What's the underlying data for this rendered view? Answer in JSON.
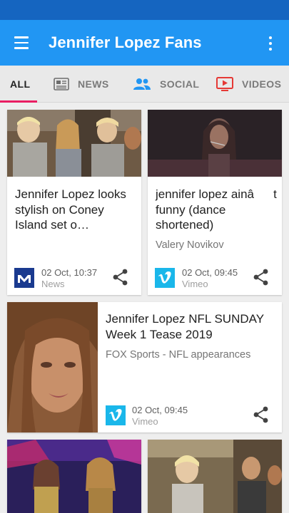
{
  "app": {
    "title": "Jennifer Lopez Fans",
    "menu_icon": "hamburger-menu-icon",
    "more_icon": "more-vert-icon"
  },
  "colors": {
    "appbar": "#2196f3",
    "statusbar": "#1565c0",
    "tab_indicator": "#e91e63",
    "videos_icon": "#e53935",
    "social_icon": "#2196f3"
  },
  "tabs": [
    {
      "label": "ALL",
      "icon": null,
      "active": true
    },
    {
      "label": "NEWS",
      "icon": "newspaper-icon",
      "active": false
    },
    {
      "label": "SOCIAL",
      "icon": "people-icon",
      "active": false
    },
    {
      "label": "VIDEOS",
      "icon": "video-play-icon",
      "active": false
    }
  ],
  "cards": [
    {
      "title": "Jennifer Lopez looks stylish on Coney Island set o…",
      "source": "",
      "date": "02 Oct, 10:37",
      "category": "News",
      "badge": "m-news-logo-icon"
    },
    {
      "title": "jennifer lopez ainât funny (dance shortened)",
      "source": "Valery Novikov",
      "date": "02 Oct, 09:45",
      "category": "Vimeo",
      "badge": "vimeo-logo-icon"
    },
    {
      "title": "Jennifer Lopez NFL SUNDAY Week 1 Tease 2019",
      "source": "FOX Sports - NFL appearances",
      "date": "02 Oct, 09:45",
      "category": "Vimeo",
      "badge": "vimeo-logo-icon"
    },
    {
      "title": "",
      "source": "",
      "date": "",
      "category": "",
      "badge": ""
    },
    {
      "title": "",
      "source": "",
      "date": "",
      "category": "",
      "badge": ""
    }
  ]
}
